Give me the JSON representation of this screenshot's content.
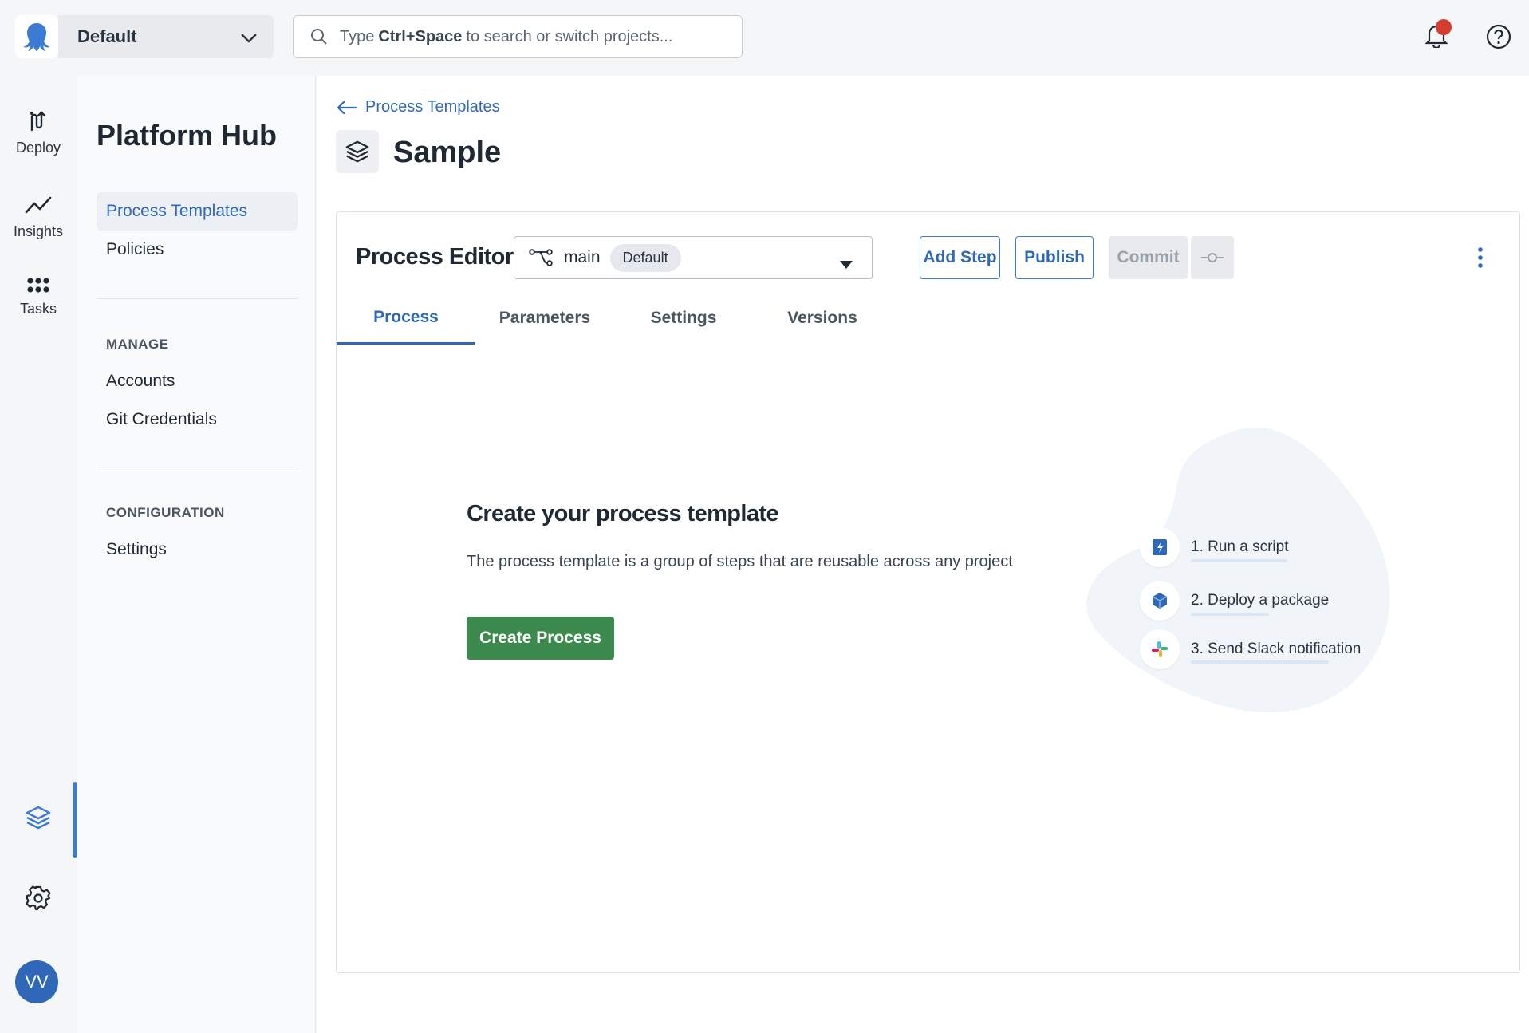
{
  "topbar": {
    "space_name": "Default",
    "search": {
      "prefix": "Type",
      "shortcut": "Ctrl+Space",
      "suffix": "to search or switch projects..."
    }
  },
  "rail": {
    "items": [
      {
        "label": "Deploy"
      },
      {
        "label": "Insights"
      },
      {
        "label": "Tasks"
      }
    ],
    "avatar_initials": "VV"
  },
  "sidepanel": {
    "title": "Platform Hub",
    "items": [
      {
        "label": "Process Templates",
        "active": true
      },
      {
        "label": "Policies"
      }
    ],
    "manage_heading": "MANAGE",
    "manage_items": [
      {
        "label": "Accounts"
      },
      {
        "label": "Git Credentials"
      }
    ],
    "config_heading": "CONFIGURATION",
    "config_items": [
      {
        "label": "Settings"
      }
    ]
  },
  "main": {
    "back_link": "Process Templates",
    "page_title": "Sample",
    "editor": {
      "title": "Process Editor",
      "branch": "main",
      "branch_badge": "Default",
      "add_step_label": "Add Step",
      "publish_label": "Publish",
      "commit_label": "Commit"
    },
    "tabs": [
      {
        "label": "Process",
        "active": true
      },
      {
        "label": "Parameters"
      },
      {
        "label": "Settings"
      },
      {
        "label": "Versions"
      }
    ],
    "empty_state": {
      "title": "Create your process template",
      "description": "The process template is a group of steps that are reusable across any project",
      "button_label": "Create Process"
    },
    "illustration_steps": [
      {
        "label": "1. Run a script"
      },
      {
        "label": "2. Deploy a package"
      },
      {
        "label": "3. Send Slack notification"
      }
    ]
  },
  "colors": {
    "accent": "#2f68b8",
    "primary_button": "#3c8a4e",
    "notification_dot": "#d63b2f"
  }
}
